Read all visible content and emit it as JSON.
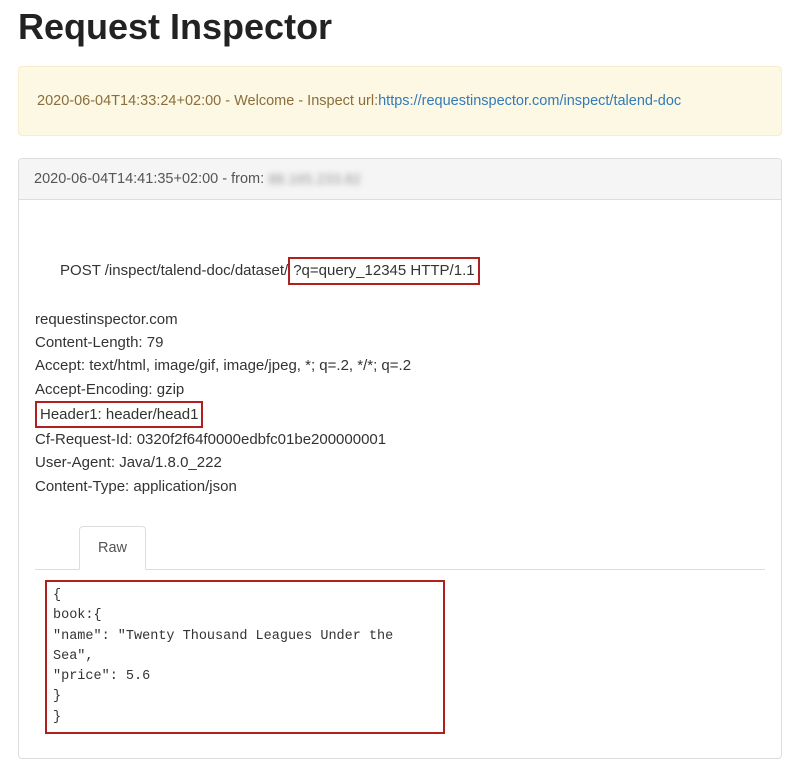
{
  "title": "Request Inspector",
  "welcome": {
    "timestamp": "2020-06-04T14:33:24+02:00",
    "message": "Welcome - Inspect url:",
    "link_text": "https://requestinspector.com/inspect/talend-doc",
    "separator": " - "
  },
  "request": {
    "heading": {
      "timestamp": "2020-06-04T14:41:35+02:00",
      "from_label": " - from: ",
      "from_ip": "88.165.233.82"
    },
    "method_path": "POST /inspect/talend-doc/dataset/",
    "query_http": "?q=query_12345 HTTP/1.1",
    "headers": {
      "host": "requestinspector.com",
      "content_length": "Content-Length: 79",
      "accept": "Accept: text/html, image/gif, image/jpeg, *; q=.2, */*; q=.2",
      "accept_encoding": "Accept-Encoding: gzip",
      "header1": "Header1: header/head1",
      "cf_request_id": "Cf-Request-Id: 0320f2f64f0000edbfc01be200000001",
      "user_agent": "User-Agent: Java/1.8.0_222",
      "content_type": "Content-Type: application/json"
    },
    "tabs": {
      "raw": "Raw"
    },
    "body": "{\nbook:{\n\"name\": \"Twenty Thousand Leagues Under the Sea\",\n\"price\": 5.6\n}\n}"
  }
}
